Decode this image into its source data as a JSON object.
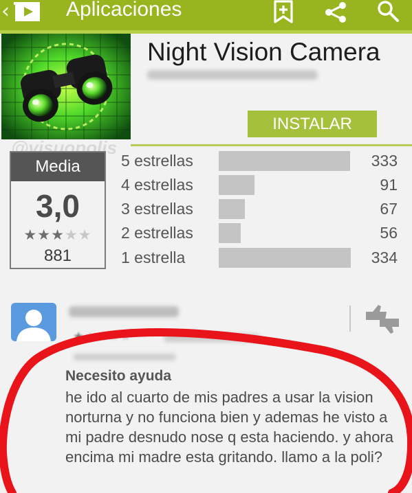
{
  "action_bar": {
    "back_glyph": "‹",
    "title": "Aplicaciones",
    "icons": [
      "back-icon",
      "play-store-logo-icon",
      "wishlist-add-icon",
      "share-icon",
      "search-icon"
    ]
  },
  "app": {
    "title": "Night Vision Camera",
    "install_label": "INSTALAR",
    "icon": "binoculars-icon"
  },
  "watermark": "@visuopolis",
  "rating": {
    "label": "Media",
    "value": "3,0",
    "stars_filled": 3,
    "stars_total": 5,
    "count": "881",
    "histogram": [
      {
        "label": "5 estrellas",
        "count": "333",
        "fraction": 0.997
      },
      {
        "label": "4 estrellas",
        "count": "91",
        "fraction": 0.272
      },
      {
        "label": "3 estrellas",
        "count": "67",
        "fraction": 0.2
      },
      {
        "label": "2 estrellas",
        "count": "56",
        "fraction": 0.168
      },
      {
        "label": "1 estrella",
        "count": "334",
        "fraction": 1.0
      }
    ]
  },
  "review": {
    "stars_filled": 1,
    "stars_total": 5,
    "title": "Necesito ayuda",
    "body": "he ido al cuarto de mis padres a usar la vision norturna y no funciona bien y ademas he visto a mi padre desnudo nose q esta haciendo. y ahora encima mi madre esta gritando. llamo a la poli?"
  },
  "colors": {
    "action_bar": "#98b520",
    "install_button": "#a5c13b",
    "annotation": "#e8141a",
    "avatar": "#5a9be0"
  }
}
